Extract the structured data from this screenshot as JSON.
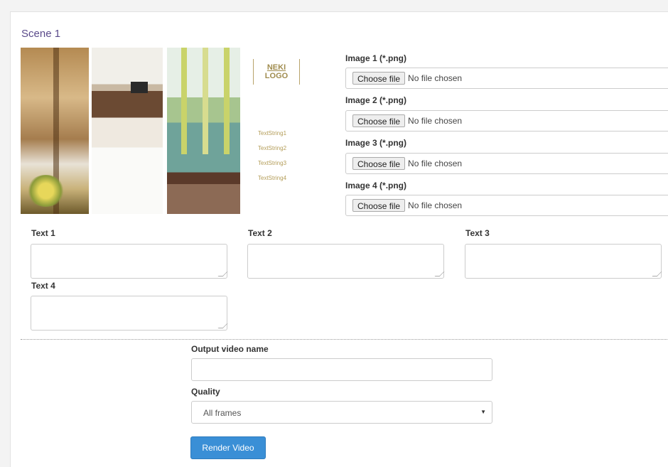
{
  "scene": {
    "title": "Scene 1"
  },
  "preview": {
    "logo_line1": "NEKI",
    "logo_line2": "LOGO",
    "text_strings": [
      "TextString1",
      "TextString2",
      "TextString3",
      "TextString4"
    ]
  },
  "images": [
    {
      "label": "Image 1 (*.png)",
      "button": "Choose file",
      "status": "No file chosen"
    },
    {
      "label": "Image 2 (*.png)",
      "button": "Choose file",
      "status": "No file chosen"
    },
    {
      "label": "Image 3 (*.png)",
      "button": "Choose file",
      "status": "No file chosen"
    },
    {
      "label": "Image 4 (*.png)",
      "button": "Choose file",
      "status": "No file chosen"
    }
  ],
  "texts": [
    {
      "label": "Text 1",
      "value": ""
    },
    {
      "label": "Text 2",
      "value": ""
    },
    {
      "label": "Text 3",
      "value": ""
    },
    {
      "label": "Text 4",
      "value": ""
    }
  ],
  "output": {
    "name_label": "Output video name",
    "name_value": "",
    "quality_label": "Quality",
    "quality_selected": "All frames",
    "render_label": "Render Video"
  },
  "colors": {
    "accent": "#3a8fd6",
    "title": "#5a4a8a",
    "logo": "#a08c4e"
  }
}
